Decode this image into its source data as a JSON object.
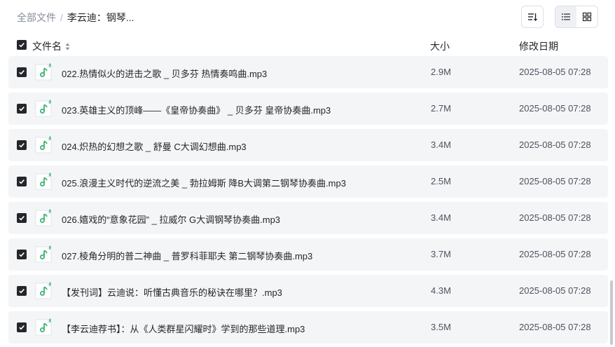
{
  "breadcrumb": {
    "root": "全部文件",
    "separator": "/",
    "current": "李云迪：钢琴..."
  },
  "toolbar": {
    "sort_icon": "sort-list-icon",
    "list_view_icon": "list-view-icon",
    "grid_view_icon": "grid-view-icon",
    "active_view": "list"
  },
  "table": {
    "headers": {
      "name": "文件名",
      "size": "大小",
      "date": "修改日期"
    },
    "all_selected": true,
    "rows": [
      {
        "name": "022.热情似火的进击之歌 _ 贝多芬 热情奏鸣曲.mp3",
        "size": "2.9M",
        "date": "2025-08-05 07:28",
        "checked": true,
        "icon": "music-file-icon"
      },
      {
        "name": "023.英雄主义的顶峰——《皇帝协奏曲》 _ 贝多芬 皇帝协奏曲.mp3",
        "size": "2.7M",
        "date": "2025-08-05 07:28",
        "checked": true,
        "icon": "music-file-icon"
      },
      {
        "name": "024.炽热的幻想之歌 _ 舒曼 C大调幻想曲.mp3",
        "size": "3.4M",
        "date": "2025-08-05 07:28",
        "checked": true,
        "icon": "music-file-icon"
      },
      {
        "name": "025.浪漫主义时代的逆流之美 _ 勃拉姆斯 降B大调第二钢琴协奏曲.mp3",
        "size": "2.5M",
        "date": "2025-08-05 07:28",
        "checked": true,
        "icon": "music-file-icon"
      },
      {
        "name": "026.嬉戏的“意象花园” _ 拉威尔 G大调钢琴协奏曲.mp3",
        "size": "3.4M",
        "date": "2025-08-05 07:28",
        "checked": true,
        "icon": "music-file-icon"
      },
      {
        "name": "027.棱角分明的普二神曲 _ 普罗科菲耶夫 第二钢琴协奏曲.mp3",
        "size": "3.7M",
        "date": "2025-08-05 07:28",
        "checked": true,
        "icon": "music-file-icon"
      },
      {
        "name": "【发刊词】云迪说：听懂古典音乐的秘诀在哪里？.mp3",
        "size": "4.3M",
        "date": "2025-08-05 07:28",
        "checked": true,
        "icon": "music-file-icon"
      },
      {
        "name": "【李云迪荐书】：从《人类群星闪耀时》学到的那些道理.mp3",
        "size": "3.5M",
        "date": "2025-08-05 07:28",
        "checked": true,
        "icon": "music-file-icon"
      }
    ]
  },
  "colors": {
    "accent_green": "#3cb371",
    "row_background": "#f4f5f7",
    "checkbox": "#25262b"
  }
}
